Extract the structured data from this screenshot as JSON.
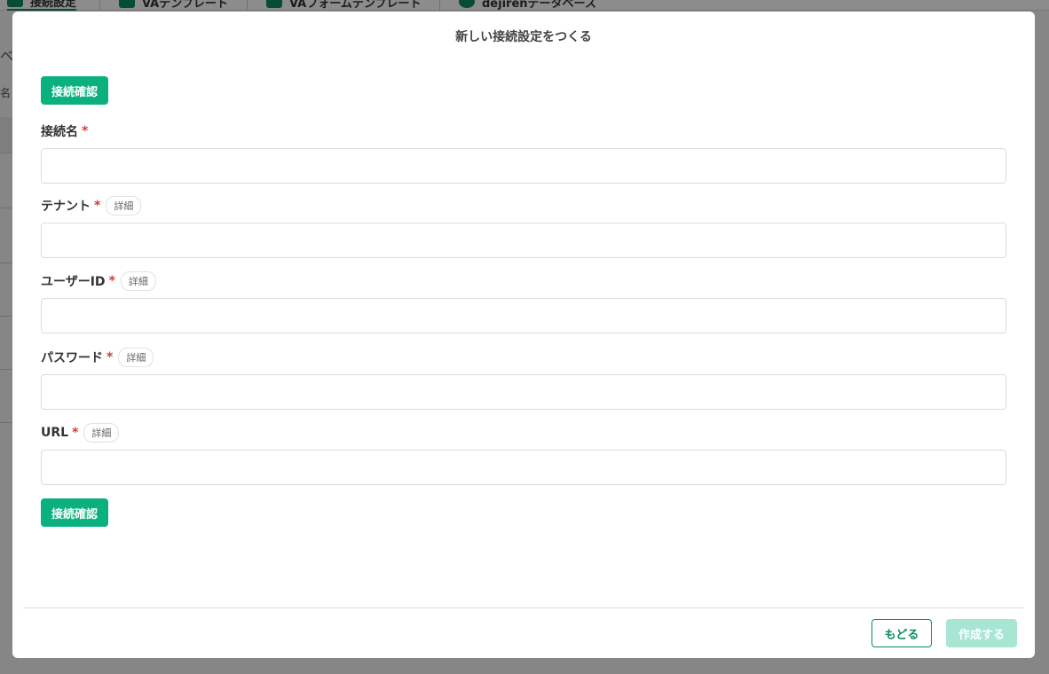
{
  "background": {
    "tabs": [
      {
        "label": "接続設定",
        "active": true
      },
      {
        "label": "VAテンプレート"
      },
      {
        "label": "VAフォームテンプレート"
      },
      {
        "label": "dejirenデータベース"
      }
    ],
    "side_texts": [
      "ベ",
      "名"
    ]
  },
  "modal": {
    "title": "新しい接続設定をつくる",
    "check_button_top": "接続確認",
    "check_button_bottom": "接続確認",
    "required_mark": "*",
    "detail_label": "詳細",
    "fields": [
      {
        "label": "接続名",
        "value": "",
        "placeholder": ""
      },
      {
        "label": "テナント",
        "value": "",
        "placeholder": ""
      },
      {
        "label": "ユーザーID",
        "value": "",
        "placeholder": ""
      },
      {
        "label": "パスワード",
        "value": "",
        "placeholder": ""
      },
      {
        "label": "URL",
        "value": "",
        "placeholder": ""
      }
    ],
    "back_button": "もどる",
    "create_button": "作成する"
  },
  "colors": {
    "primary": "#0bb07f",
    "primary_disabled": "#a6e6d3",
    "outline": "#0c8c5c",
    "required": "#d63a3a"
  }
}
